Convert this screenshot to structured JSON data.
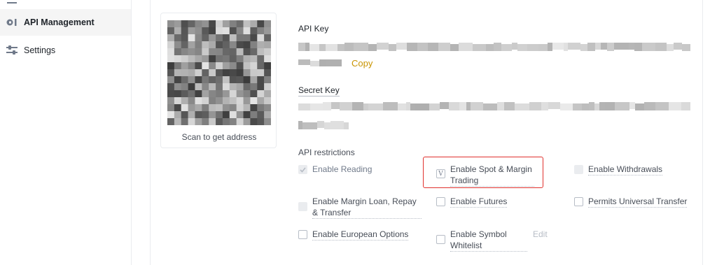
{
  "sidebar": {
    "items": [
      {
        "label": "API Management",
        "icon": "api-icon",
        "active": true
      },
      {
        "label": "Settings",
        "icon": "sliders-icon",
        "active": false
      }
    ]
  },
  "qr": {
    "caption": "Scan to get address"
  },
  "api_key": {
    "label": "API Key",
    "copy_label": "Copy"
  },
  "secret_key": {
    "label": "Secret Key"
  },
  "restrictions": {
    "title": "API restrictions",
    "options": [
      {
        "label": "Enable Reading",
        "checked": true,
        "disabled": true
      },
      {
        "label": "Enable Spot & Margin Trading",
        "checked": true,
        "disabled": false,
        "mark": "V"
      },
      {
        "label": "Enable Withdrawals",
        "checked": false,
        "disabled": true
      },
      {
        "label": "Enable Margin Loan, Repay & Transfer",
        "checked": false,
        "disabled": true
      },
      {
        "label": "Enable Futures",
        "checked": false,
        "disabled": false
      },
      {
        "label": "Permits Universal Transfer",
        "checked": false,
        "disabled": false
      },
      {
        "label": "Enable European Options",
        "checked": false,
        "disabled": false
      },
      {
        "label": "Enable Symbol Whitelist",
        "checked": false,
        "disabled": false
      }
    ],
    "edit_label": "Edit"
  },
  "colors": {
    "accent": "#c99400",
    "highlight": "#e0312d",
    "text": "#1e2329",
    "muted": "#707a8a",
    "border": "#eaecef"
  }
}
